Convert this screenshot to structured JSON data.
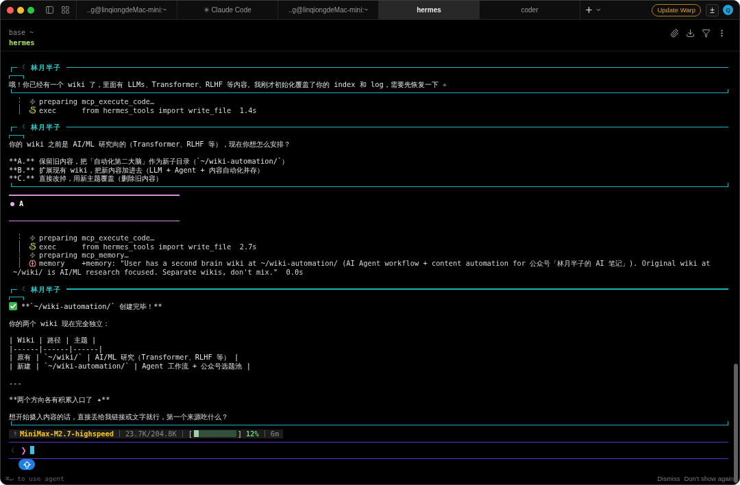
{
  "window": {
    "tabs": [
      {
        "label": "..g@linqiongdeMac-mini:~",
        "selected": false
      },
      {
        "label": "✳ Claude Code",
        "selected": false
      },
      {
        "label": "..g@linqiongdeMac-mini:~",
        "selected": false
      },
      {
        "label": "hermes",
        "selected": true
      },
      {
        "label": "coder",
        "selected": false
      }
    ],
    "update_button": "Update Warp",
    "toggle_button": "±",
    "avatar": "Q"
  },
  "header": {
    "environment": "base ~",
    "session": "hermes"
  },
  "transcript": [
    {
      "kind": "message",
      "symbol": "☾",
      "author": "林月半子",
      "paragraphs": [
        {
          "kind": "plain",
          "lines": [
            "哦！你已经有一个 wiki 了，里面有 LLMs、Transformer、RLHF 等内容。我刚才初始化覆盖了你的 index 和 log，需要先恢复一下 ✧"
          ]
        }
      ]
    },
    {
      "kind": "tools",
      "steps": [
        {
          "kind": "prepare",
          "label": "preparing",
          "detail": "mcp_execute_code…"
        },
        {
          "kind": "exec",
          "label": "exec",
          "detail": "from hermes_tools import write_file  1.4s"
        }
      ]
    },
    {
      "kind": "message",
      "symbol": "☾",
      "author": "林月半子",
      "paragraphs": [
        {
          "kind": "plain",
          "lines": [
            "你的 wiki 之前是 AI/ML 研究向的（Transformer、RLHF 等），现在你想怎么安排？"
          ]
        },
        {
          "kind": "plain",
          "lines": [
            "**A.** 保留旧内容，把「自动化第二大脑」作为新子目录（`~/wiki-automation/`）",
            "**B.** 扩展现有 wiki，把新内容加进去（LLM + Agent + 内容自动化并存）",
            "**C.** 直接改掉，用新主题覆盖（删除旧内容）"
          ]
        }
      ]
    },
    {
      "kind": "user",
      "text": "A"
    },
    {
      "kind": "tools",
      "steps": [
        {
          "kind": "prepare",
          "label": "preparing",
          "detail": "mcp_execute_code…"
        },
        {
          "kind": "exec",
          "label": "exec",
          "detail": "from hermes_tools import write_file  2.7s"
        },
        {
          "kind": "prepare",
          "label": "preparing",
          "detail": "mcp_memory…"
        },
        {
          "kind": "memory",
          "label": "memory",
          "detail": "+memory: \"User has a second brain wiki at ~/wiki-automation/ (AI Agent workflow + content automation for 公众号「林月半子的 AI 笔记」). Original wiki at",
          "continuation": "~/wiki/ is AI/ML research focused. Separate wikis, don't mix.\"  0.0s"
        }
      ]
    },
    {
      "kind": "message",
      "symbol": "☾",
      "author": "林月半子",
      "paragraphs": [
        {
          "kind": "done",
          "lines": [
            "**`~/wiki-automation/` 创建完毕！**"
          ]
        },
        {
          "kind": "plain",
          "lines": [
            "你的两个 wiki 现在完全独立："
          ]
        },
        {
          "kind": "plain",
          "lines": [
            "| Wiki | 路径 | 主题 |",
            "|------|------|------|",
            "| 原有 | `~/wiki/` | AI/ML 研究（Transformer、RLHF 等） |",
            "| 新建 | `~/wiki-automation/` | Agent 工作流 + 公众号选题池 |"
          ]
        },
        {
          "kind": "plain",
          "lines": [
            "---"
          ]
        },
        {
          "kind": "plain",
          "lines": [
            "**两个方向各有积累入口了 ✦**"
          ]
        },
        {
          "kind": "plain",
          "lines": [
            "想开始摄入内容的话，直接丢给我链接或文字就行，第一个来源吃什么？"
          ]
        }
      ]
    }
  ],
  "status": {
    "symbol": "⚕",
    "model": "MiniMax-M2.7-highspeed",
    "tokens": "23.7K/204.8K",
    "context": {
      "open": "[",
      "level": 0.12,
      "close": "]",
      "percent": "12%"
    },
    "elapsed": "6m"
  },
  "input": {
    "symbol": "☾",
    "arrow": "❯"
  },
  "hint": {
    "text": "⌘↵ to use agent",
    "actions": [
      "Dismiss",
      "Don't show again"
    ]
  }
}
